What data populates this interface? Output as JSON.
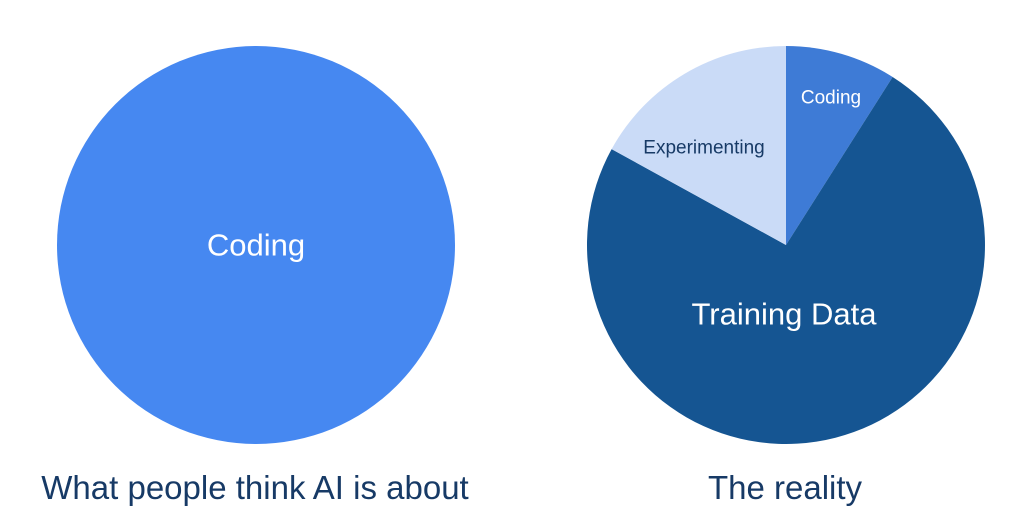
{
  "chart_data": [
    {
      "type": "pie",
      "slices": [
        {
          "label": "Coding",
          "value": 100,
          "color": "#4688f1"
        }
      ],
      "caption": "What people think AI is about"
    },
    {
      "type": "pie",
      "slices": [
        {
          "label": "Coding",
          "value": 9,
          "color": "#3e7bd6"
        },
        {
          "label": "Training Data",
          "value": 74,
          "color": "#155592"
        },
        {
          "label": "Experimenting",
          "value": 17,
          "color": "#cadbf7"
        }
      ],
      "caption": "The reality"
    }
  ],
  "colors": {
    "caption_text": "#173a66",
    "label_light": "#ffffff",
    "label_dark": "#173a66"
  }
}
